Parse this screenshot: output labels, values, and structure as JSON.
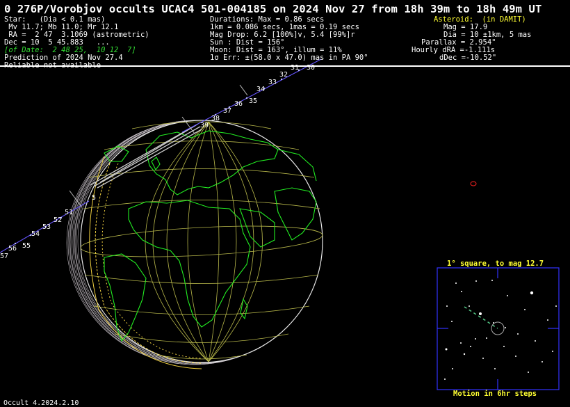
{
  "title": "0 276P/Vorobjov occults UCAC4 501-004185 on 2024 Nov 27 from 18h 39m to 18h 49m UT",
  "star": {
    "line1": "Star:   (Dia < 0.1 mas)",
    "line2": " Mv 11.7; Mb 11.0; Mr 12.1",
    "line3": " RA =  2 47  3.1069 (astrometric)",
    "line4": "Dec = 10  5 45.883   ...",
    "line5": "[of Date:  2 48 25,  10 12  7]",
    "line6": "Prediction of 2024 Nov 27.4",
    "line7": "Reliable not available"
  },
  "durations": {
    "line1": "Durations: Max = 0.86 secs",
    "line2": "1km = 0.086 secs, 1mas = 0.19 secs",
    "line3": "Mag Drop: 6.2 [100%]v, 5.4 [99%]r",
    "line4": "Sun : Dist = 156°",
    "line5": "Moon: Dist = 163°, illum = 11%",
    "line6": "1σ Err: ±(58.0 x 47.0) mas in PA 90°"
  },
  "asteroid": {
    "line1": "Asteroid:  (in DAMIT)",
    "line2": "Mag = 17.9",
    "line3": "Dia = 10 ±1km, 5 mas",
    "line4": "Parallax = 2.954\"",
    "line5": "Hourly dRA =-1.111s",
    "line6": "dDec =-10.52\""
  },
  "track_labels": [
    "30",
    "31",
    "32",
    "33",
    "34",
    "35",
    "36",
    "37",
    "38",
    "39",
    "51",
    "52",
    "53",
    "54",
    "55",
    "56",
    "57"
  ],
  "track_label_5": "5",
  "inset": {
    "title": "1° square, to mag 12.7",
    "caption": "Motion in 6hr steps"
  },
  "footer": "Occult 4.2024.2.10",
  "colors": {
    "background": "#000000",
    "text": "#ffffff",
    "grid": "#b8b84a",
    "coast": "#22ee22",
    "track": "#6655ff",
    "asteroid_note": "#ffff33",
    "inset_frame": "#3333ff"
  }
}
